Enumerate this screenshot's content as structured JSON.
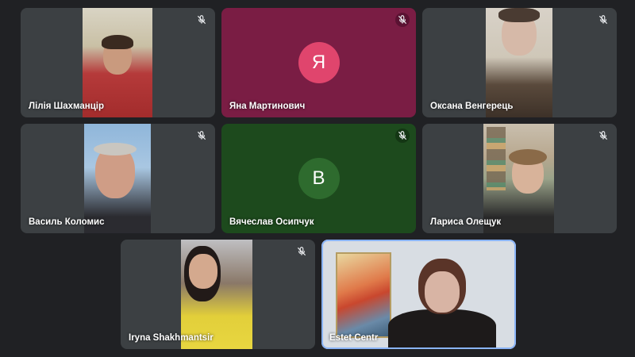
{
  "participants": [
    {
      "name": "Лілія Шахманцір",
      "type": "video",
      "muted": true
    },
    {
      "name": "Яна Мартинович",
      "type": "avatar",
      "initial": "Я",
      "muted": true
    },
    {
      "name": "Оксана Венгерець",
      "type": "video",
      "muted": true
    },
    {
      "name": "Василь Коломис",
      "type": "video",
      "muted": true
    },
    {
      "name": "Вячеслав Осипчук",
      "type": "avatar",
      "initial": "В",
      "muted": true
    },
    {
      "name": "Лариса Олещук",
      "type": "video",
      "muted": true
    },
    {
      "name": "Iryna Shakhmantsir",
      "type": "video",
      "muted": true
    },
    {
      "name": "Estet Centr",
      "type": "video",
      "muted": false,
      "active_speaker": true
    }
  ],
  "icons": {
    "mic_muted": "mic-off-icon"
  },
  "colors": {
    "background": "#202124",
    "tile": "#3c4043",
    "yana_bg": "#7a1d44",
    "yana_avatar": "#e0456d",
    "vyacheslav_bg": "#1d4a1d",
    "vyacheslav_avatar": "#2e6b2e",
    "active_border": "#8ab4f8"
  }
}
